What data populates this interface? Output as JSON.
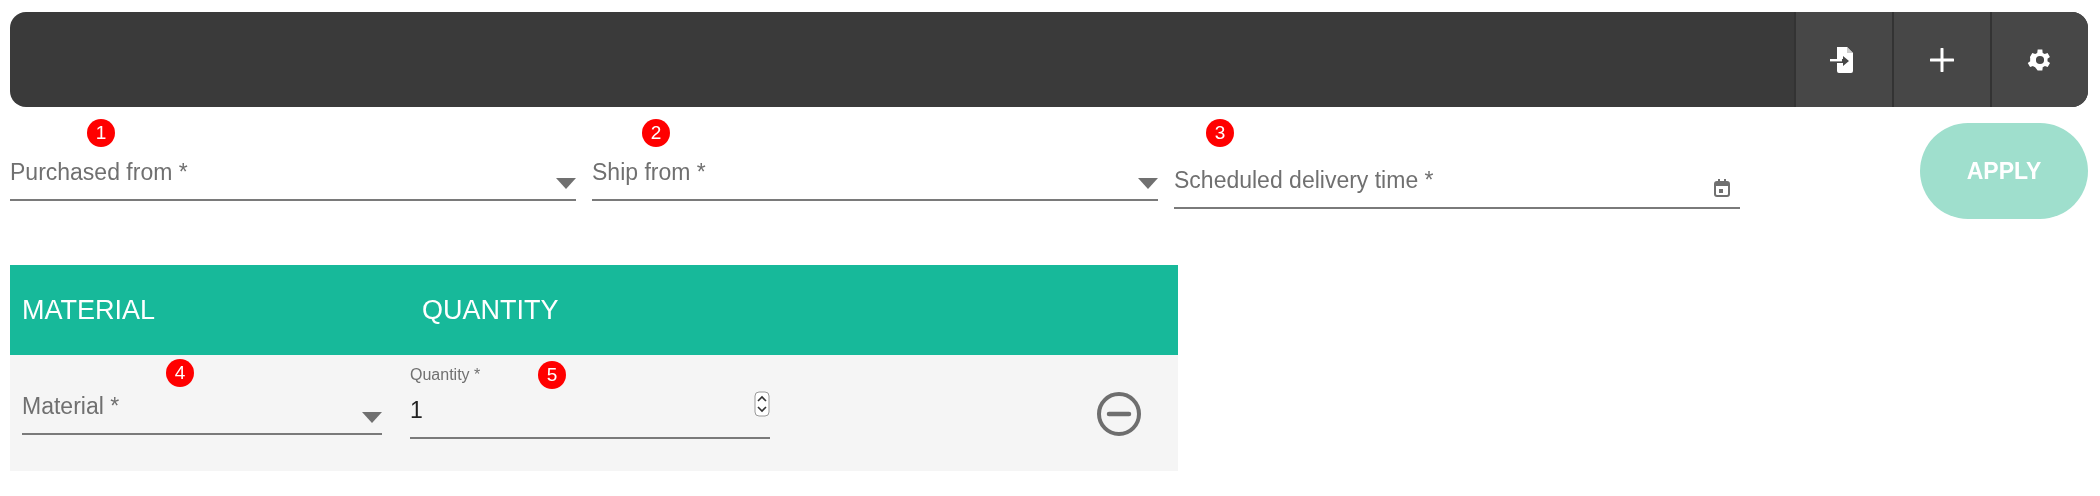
{
  "toolbar": {
    "buttons": [
      {
        "kind": "import"
      },
      {
        "kind": "add"
      },
      {
        "kind": "settings"
      }
    ]
  },
  "filters": [
    {
      "kind": "select",
      "placeholder": "Purchased from *",
      "badge": "1"
    },
    {
      "kind": "select",
      "placeholder": "Ship from *",
      "badge": "2"
    },
    {
      "kind": "date",
      "placeholder": "Scheduled delivery time *",
      "badge": "3"
    }
  ],
  "apply_button": {
    "label": "APPLY",
    "disabled": true
  },
  "table": {
    "columns": [
      "MATERIAL",
      "QUANTITY"
    ],
    "rows": [
      {
        "material": {
          "placeholder": "Material *",
          "badge": "4"
        },
        "quantity": {
          "label": "Quantity *",
          "value": "1",
          "badge": "5"
        }
      }
    ]
  }
}
